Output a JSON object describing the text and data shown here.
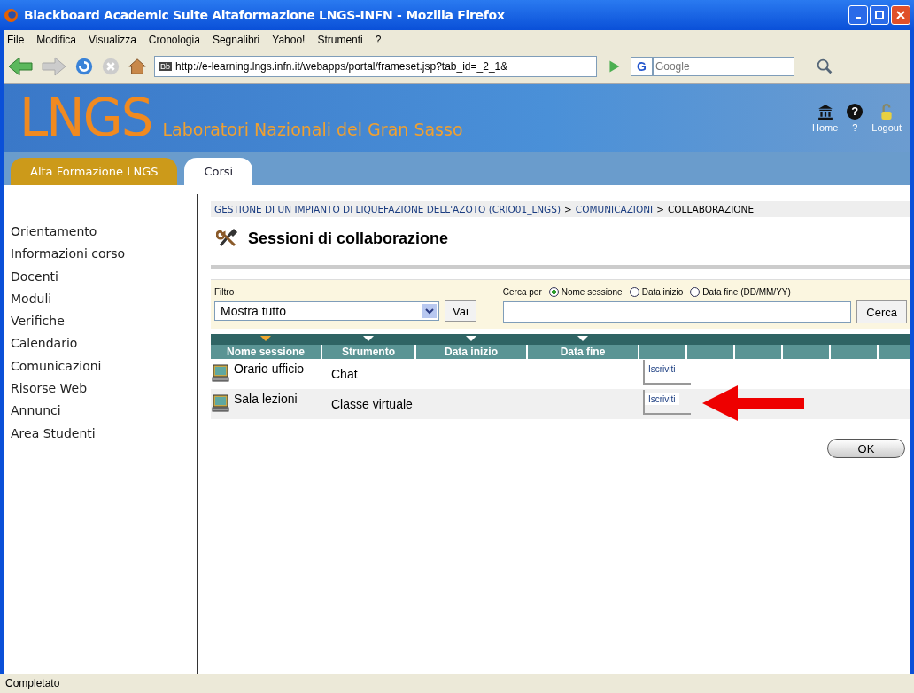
{
  "window": {
    "title": "Blackboard Academic Suite Altaformazione LNGS-INFN - Mozilla Firefox"
  },
  "menu_bar": [
    "File",
    "Modifica",
    "Visualizza",
    "Cronologia",
    "Segnalibri",
    "Yahoo!",
    "Strumenti",
    "?"
  ],
  "address_bar": {
    "site_icon": "Bb",
    "value": "http://e-learning.lngs.infn.it/webapps/portal/frameset.jsp?tab_id=_2_1&"
  },
  "search_box": {
    "engine_icon": "G",
    "placeholder": "Google"
  },
  "banner": {
    "logo": "LNGS",
    "subtitle": "Laboratori Nazionali del Gran Sasso",
    "links": [
      "Home",
      "?",
      "Logout"
    ],
    "help_glyph": "?"
  },
  "tabs": [
    {
      "label": "Alta Formazione LNGS",
      "selected": false
    },
    {
      "label": "Corsi",
      "selected": true
    }
  ],
  "sidebar": {
    "items": [
      "Orientamento",
      "Informazioni corso",
      "Docenti",
      "Moduli",
      "Verifiche",
      "Calendario",
      "Comunicazioni",
      "Risorse Web",
      "Annunci",
      "Area Studenti"
    ]
  },
  "breadcrumb": {
    "links": [
      "GESTIONE DI UN IMPIANTO DI LIQUEFAZIONE DELL'AZOTO (CRIO01_LNGS)",
      "COMUNICAZIONI"
    ],
    "current": "COLLABORAZIONE",
    "separator": ">"
  },
  "page_title": "Sessioni di collaborazione",
  "filter": {
    "label": "Filtro",
    "value": "Mostra tutto",
    "button": "Vai"
  },
  "search": {
    "label": "Cerca per",
    "options": [
      {
        "label": "Nome sessione",
        "selected": true
      },
      {
        "label": "Data inizio",
        "selected": false
      },
      {
        "label": "Data fine (DD/MM/YY)",
        "selected": false
      }
    ],
    "button": "Cerca"
  },
  "table": {
    "columns": [
      {
        "label": "Nome sessione",
        "sorted": true
      },
      {
        "label": "Strumento",
        "sorted": false
      },
      {
        "label": "Data inizio",
        "sorted": false
      },
      {
        "label": "Data fine",
        "sorted": false
      }
    ],
    "rows": [
      {
        "name": "Orario ufficio",
        "tool": "Chat",
        "action": "Iscriviti",
        "highlighted": false
      },
      {
        "name": "Sala lezioni",
        "tool": "Classe virtuale",
        "action": "Iscriviti",
        "highlighted": true
      }
    ]
  },
  "ok_button": "OK",
  "status_bar": "Completato"
}
